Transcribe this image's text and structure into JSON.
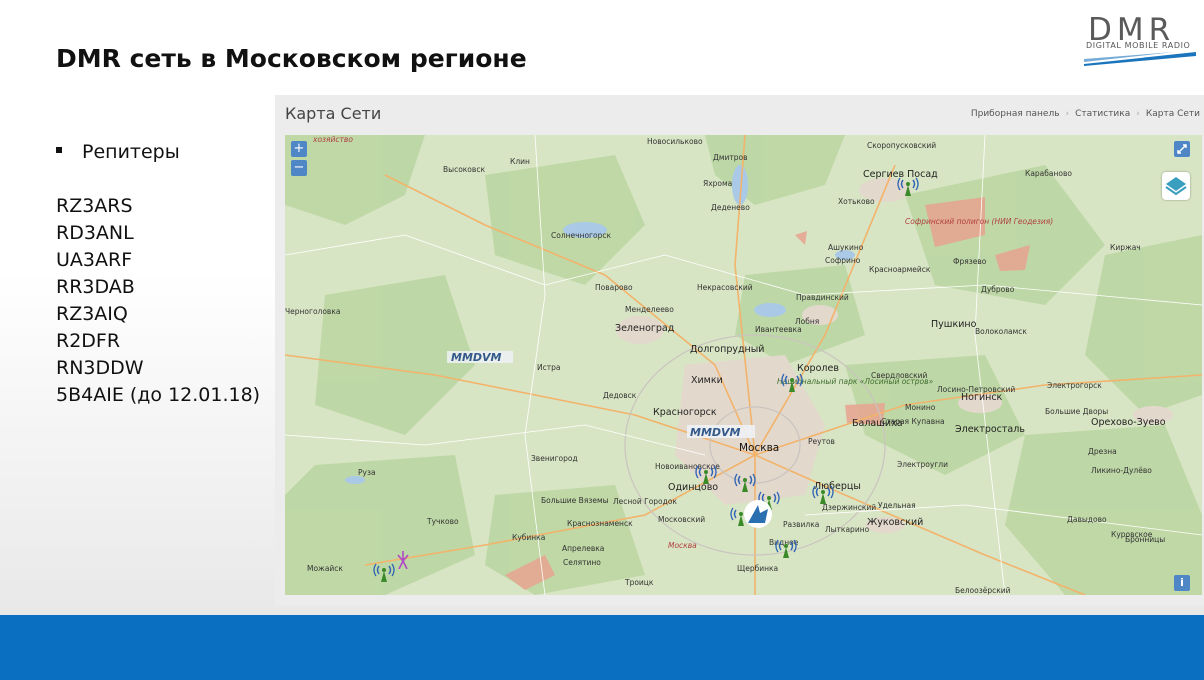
{
  "slide": {
    "title": "DMR сеть в Московском регионе",
    "logo": {
      "text": "DMR",
      "subtitle": "DIGITAL MOBILE RADIO"
    },
    "bullet": "Репитеры",
    "repeaters": [
      "RZ3ARS",
      "RD3ANL",
      "UA3ARF",
      "RR3DAB",
      "RZ3AIQ",
      "R2DFR",
      "RN3DDW",
      "5B4AIE (до 12.01.18)"
    ]
  },
  "panel": {
    "title": "Карта Сети",
    "breadcrumbs": [
      "Приборная панель",
      "Статистика",
      "Карта Сети"
    ]
  },
  "map": {
    "zoom_in": "+",
    "zoom_out": "−",
    "fullscreen_icon": "fullscreen-icon",
    "layers_icon": "layers-icon",
    "info": "i",
    "watermark": "MMDVM",
    "labels": [
      {
        "text": "хозяйство",
        "cls": "red"
      },
      {
        "text": "Новосильково",
        "cls": ""
      },
      {
        "text": "Скоропусковский",
        "cls": ""
      },
      {
        "text": "Клин",
        "cls": ""
      },
      {
        "text": "Дмитров",
        "cls": ""
      },
      {
        "text": "Высоковск",
        "cls": ""
      },
      {
        "text": "Яхрома",
        "cls": ""
      },
      {
        "text": "Сергиев Посад",
        "cls": "big"
      },
      {
        "text": "Карабаново",
        "cls": ""
      },
      {
        "text": "Деденево",
        "cls": ""
      },
      {
        "text": "Хотьково",
        "cls": ""
      },
      {
        "text": "Софринский полигон (НИИ Геодезия)",
        "cls": "red"
      },
      {
        "text": "Солнечногорск",
        "cls": ""
      },
      {
        "text": "Ашукино",
        "cls": ""
      },
      {
        "text": "Софрино",
        "cls": ""
      },
      {
        "text": "Фрязево",
        "cls": ""
      },
      {
        "text": "Киржач",
        "cls": ""
      },
      {
        "text": "Красноармейск",
        "cls": ""
      },
      {
        "text": "Поварово",
        "cls": ""
      },
      {
        "text": "Некрасовский",
        "cls": ""
      },
      {
        "text": "Дуброво",
        "cls": ""
      },
      {
        "text": "Менделеево",
        "cls": ""
      },
      {
        "text": "Правдинский",
        "cls": ""
      },
      {
        "text": "Лобня",
        "cls": ""
      },
      {
        "text": "Пушкино",
        "cls": "big"
      },
      {
        "text": "Черноголовка",
        "cls": ""
      },
      {
        "text": "Волоколамск",
        "cls": ""
      },
      {
        "text": "Зеленоград",
        "cls": "big"
      },
      {
        "text": "Ивантеевка",
        "cls": ""
      },
      {
        "text": "Долгопрудный",
        "cls": "big"
      },
      {
        "text": "Королев",
        "cls": "big"
      },
      {
        "text": "Истра",
        "cls": ""
      },
      {
        "text": "Химки",
        "cls": "big"
      },
      {
        "text": "Свердловский",
        "cls": ""
      },
      {
        "text": "Старая Купавна",
        "cls": ""
      },
      {
        "text": "Лосино-Петровский",
        "cls": ""
      },
      {
        "text": "Электрогорск",
        "cls": ""
      },
      {
        "text": "Национальный парк «Лосиный остров»",
        "cls": "green"
      },
      {
        "text": "Дедовск",
        "cls": ""
      },
      {
        "text": "Монино",
        "cls": ""
      },
      {
        "text": "Ногинск",
        "cls": "big"
      },
      {
        "text": "Красногорск",
        "cls": "big"
      },
      {
        "text": "Балашиха",
        "cls": "big"
      },
      {
        "text": "Электросталь",
        "cls": "big"
      },
      {
        "text": "Большие Дворы",
        "cls": ""
      },
      {
        "text": "Орехово-Зуево",
        "cls": "big"
      },
      {
        "text": "Москва",
        "cls": "city"
      },
      {
        "text": "Реутов",
        "cls": ""
      },
      {
        "text": "Звенигород",
        "cls": ""
      },
      {
        "text": "Электроугли",
        "cls": ""
      },
      {
        "text": "Дрезна",
        "cls": ""
      },
      {
        "text": "Новоивановское",
        "cls": ""
      },
      {
        "text": "Руза",
        "cls": ""
      },
      {
        "text": "Ликино-Дулёво",
        "cls": ""
      },
      {
        "text": "Одинцово",
        "cls": "big"
      },
      {
        "text": "Люберцы",
        "cls": "big"
      },
      {
        "text": "Большие Вяземы",
        "cls": ""
      },
      {
        "text": "Лесной Городок",
        "cls": ""
      },
      {
        "text": "Дзержинский",
        "cls": ""
      },
      {
        "text": "Удельная",
        "cls": ""
      },
      {
        "text": "Тучково",
        "cls": ""
      },
      {
        "text": "Краснознаменск",
        "cls": ""
      },
      {
        "text": "Московский",
        "cls": ""
      },
      {
        "text": "Развилка",
        "cls": ""
      },
      {
        "text": "Лыткарино",
        "cls": ""
      },
      {
        "text": "Жуковский",
        "cls": "big"
      },
      {
        "text": "Давыдово",
        "cls": ""
      },
      {
        "text": "Кубинка",
        "cls": ""
      },
      {
        "text": "Москва",
        "cls": "red"
      },
      {
        "text": "Видное",
        "cls": ""
      },
      {
        "text": "Куровское",
        "cls": ""
      },
      {
        "text": "Апрелевка",
        "cls": ""
      },
      {
        "text": "Бронницы",
        "cls": ""
      },
      {
        "text": "Селятино",
        "cls": ""
      },
      {
        "text": "Щербинка",
        "cls": ""
      },
      {
        "text": "Можайск",
        "cls": ""
      },
      {
        "text": "Троицк",
        "cls": ""
      },
      {
        "text": "Белоозёрский",
        "cls": ""
      }
    ]
  },
  "colors": {
    "footer": "#0a6fc0",
    "map_land": "#d8e5c4",
    "forest": "#b9d3a0",
    "water": "#a9c9e6",
    "city": "#e2d8cf",
    "red_zone": "#e7a38f",
    "button": "#4f86c6"
  }
}
